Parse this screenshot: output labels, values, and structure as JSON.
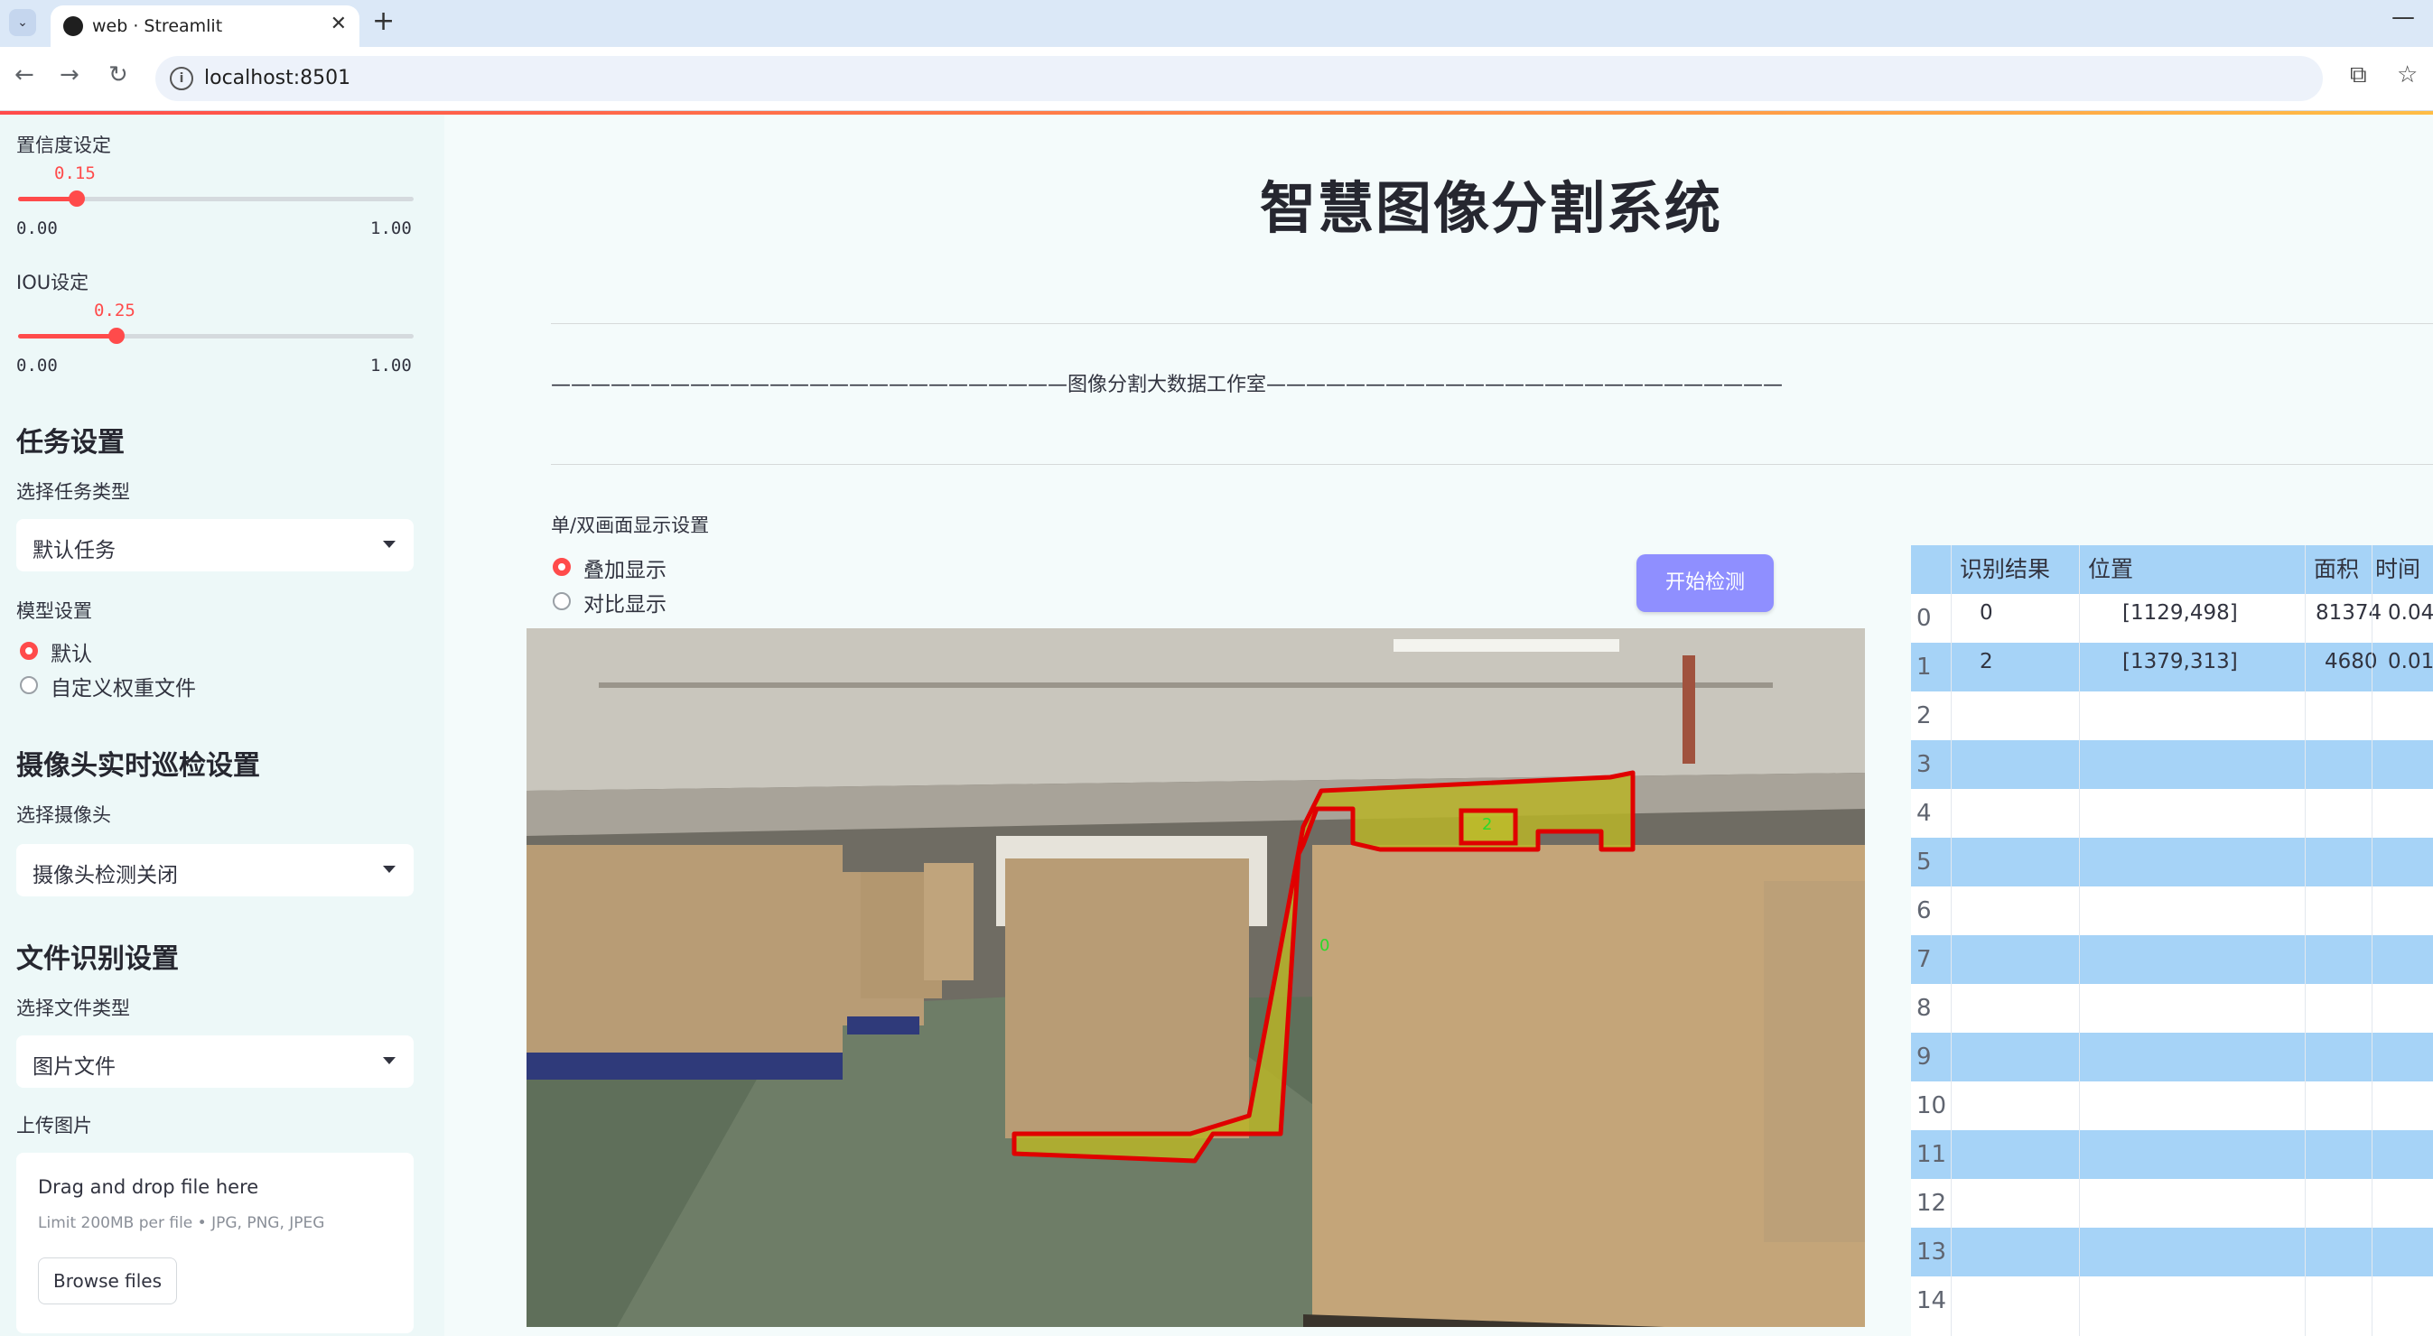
{
  "browser": {
    "tab_title": "web · Streamlit",
    "url": "localhost:8501"
  },
  "sidebar": {
    "confidence": {
      "label": "置信度设定",
      "value_text": "0.15",
      "value": 0.15,
      "min": "0.00",
      "max": "1.00"
    },
    "iou": {
      "label": "IOU设定",
      "value_text": "0.25",
      "value": 0.25,
      "min": "0.00",
      "max": "1.00"
    },
    "task_header": "任务设置",
    "task_type_label": "选择任务类型",
    "task_type_value": "默认任务",
    "model_label": "模型设置",
    "model_options": [
      "默认",
      "自定义权重文件"
    ],
    "camera_header": "摄像头实时巡检设置",
    "camera_label": "选择摄像头",
    "camera_value": "摄像头检测关闭",
    "file_header": "文件识别设置",
    "file_type_label": "选择文件类型",
    "file_type_value": "图片文件",
    "upload_label": "上传图片",
    "upload_main": "Drag and drop file here",
    "upload_sub": "Limit 200MB per file • JPG, PNG, JPEG",
    "browse_label": "Browse files"
  },
  "main": {
    "title": "智慧图像分割系统",
    "subtitle_line": "——————————————————————————图像分割大数据工作室——————————————————————————",
    "display_label": "单/双画面显示设置",
    "display_options": [
      "叠加显示",
      "对比显示"
    ],
    "start_button": "开始检测",
    "overlay_labels": [
      "0",
      "2"
    ]
  },
  "table": {
    "columns": [
      "识别结果",
      "位置",
      "面积",
      "时间"
    ],
    "rows": [
      {
        "index": "0",
        "result": "0",
        "position": "[1129,498]",
        "area": "81374",
        "time": "0.04"
      },
      {
        "index": "1",
        "result": "2",
        "position": "[1379,313]",
        "area": "4680",
        "time": "0.01"
      },
      {
        "index": "2"
      },
      {
        "index": "3"
      },
      {
        "index": "4"
      },
      {
        "index": "5"
      },
      {
        "index": "6"
      },
      {
        "index": "7"
      },
      {
        "index": "8"
      },
      {
        "index": "9"
      },
      {
        "index": "10"
      },
      {
        "index": "11"
      },
      {
        "index": "12"
      },
      {
        "index": "13"
      },
      {
        "index": "14"
      }
    ]
  }
}
